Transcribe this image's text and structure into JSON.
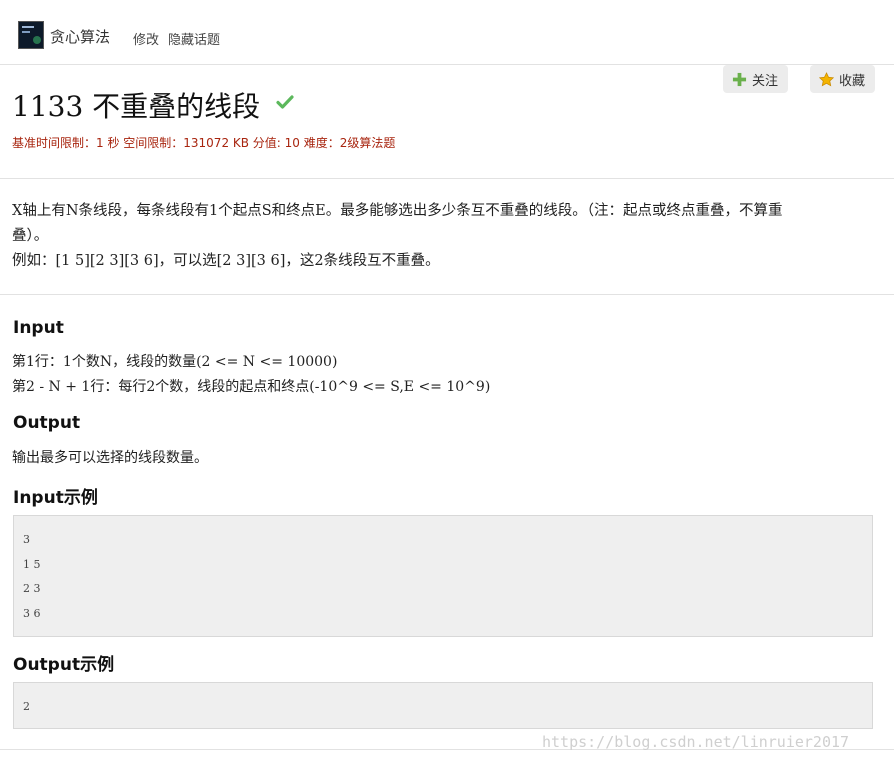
{
  "topic": {
    "icon": "topic-thumbnail-icon",
    "name": "贪心算法",
    "edit_label": "修改",
    "hide_label": "隐藏话题"
  },
  "actions": {
    "follow_label": "关注",
    "follow_icon": "plus-icon",
    "favorite_label": "收藏",
    "favorite_icon": "star-icon"
  },
  "problem": {
    "title": "1133 不重叠的线段",
    "solved_icon": "check-icon",
    "limits": "基准时间限制：1 秒 空间限制：131072 KB 分值: 10 难度：2级算法题",
    "description_lines": [
      "X轴上有N条线段，每条线段有1个起点S和终点E。最多能够选出多少条互不重叠的线段。（注：起点或终点重叠，不算重",
      "叠）。",
      "例如：[1 5][2 3][3 6]，可以选[2 3][3 6]，这2条线段互不重叠。"
    ]
  },
  "input_section": {
    "heading": "Input",
    "lines": [
      "第1行：1个数N，线段的数量(2 <= N <= 10000)",
      "第2 - N + 1行：每行2个数，线段的起点和终点(-10^9 <= S,E <= 10^9)"
    ]
  },
  "output_section": {
    "heading": "Output",
    "text": "输出最多可以选择的线段数量。"
  },
  "input_example": {
    "heading": "Input示例",
    "lines": [
      "3",
      "1 5",
      "2 3",
      "3 6"
    ]
  },
  "output_example": {
    "heading": "Output示例",
    "lines": [
      "2"
    ]
  },
  "watermark": "https://blog.csdn.net/linruier2017",
  "colors": {
    "limits_text": "#a8250f",
    "code_background": "#efefef",
    "divider": "#e2e2e2"
  }
}
